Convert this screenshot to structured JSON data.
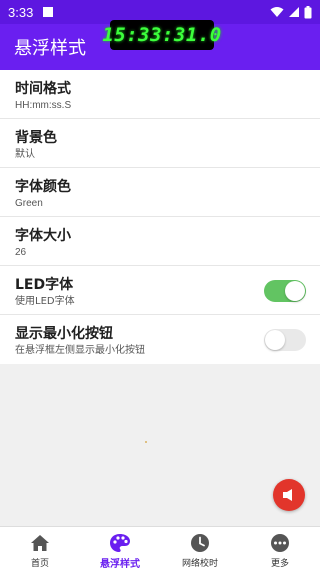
{
  "status_bar": {
    "time": "3:33"
  },
  "floating_clock": {
    "time": "15:33:31.0",
    "digit_color": "#3cff3c"
  },
  "app_bar": {
    "title": "悬浮样式",
    "color": "#6a1ff0"
  },
  "settings": [
    {
      "title": "时间格式",
      "subtitle": "HH:mm:ss.S"
    },
    {
      "title": "背景色",
      "subtitle": "默认"
    },
    {
      "title": "字体颜色",
      "subtitle": "Green"
    },
    {
      "title": "字体大小",
      "subtitle": "26"
    },
    {
      "title": "LED字体",
      "subtitle": "使用LED字体",
      "toggle": true
    },
    {
      "title": "显示最小化按钮",
      "subtitle": "在悬浮框左侧显示最小化按钮",
      "toggle": false
    }
  ],
  "fab": {
    "icon": "speaker-icon",
    "color": "#e2352b"
  },
  "bottom_nav": [
    {
      "label": "首页",
      "icon": "home-icon",
      "active": false
    },
    {
      "label": "悬浮样式",
      "icon": "palette-icon",
      "active": true
    },
    {
      "label": "网络校时",
      "icon": "clock-icon",
      "active": false
    },
    {
      "label": "更多",
      "icon": "more-icon",
      "active": false
    }
  ]
}
